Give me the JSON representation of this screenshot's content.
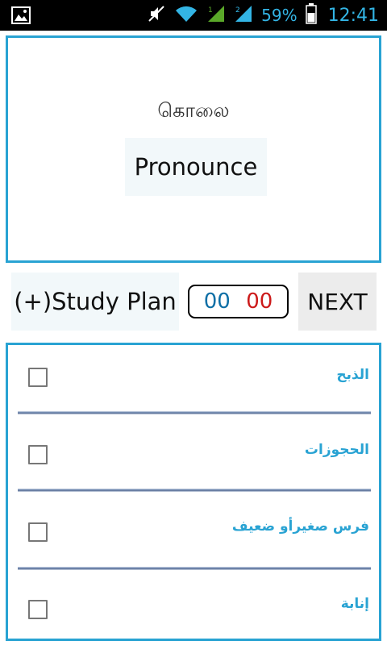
{
  "status_bar": {
    "battery_percent": "59%",
    "time": "12:41",
    "icons": [
      "gallery-notification-icon",
      "mute-icon",
      "wifi-icon",
      "signal-1-icon",
      "signal-2-icon",
      "battery-icon"
    ]
  },
  "word_card": {
    "word": "கொலை",
    "pronounce_label": "Pronounce"
  },
  "controls": {
    "study_plan_label": "(+)Study Plan",
    "timer_minutes": "00",
    "timer_seconds": "00",
    "next_label": "NEXT"
  },
  "options": [
    {
      "label": "الذبح",
      "checked": false
    },
    {
      "label": "الحجوزات",
      "checked": false
    },
    {
      "label": "فرس صغيرأو ضعيف",
      "checked": false
    },
    {
      "label": "إنابة",
      "checked": false
    }
  ],
  "colors": {
    "accent": "#29a3d3",
    "timer_minutes": "#0e6fa6",
    "timer_seconds": "#cc1a1a",
    "status_blue": "#33b5e5"
  }
}
